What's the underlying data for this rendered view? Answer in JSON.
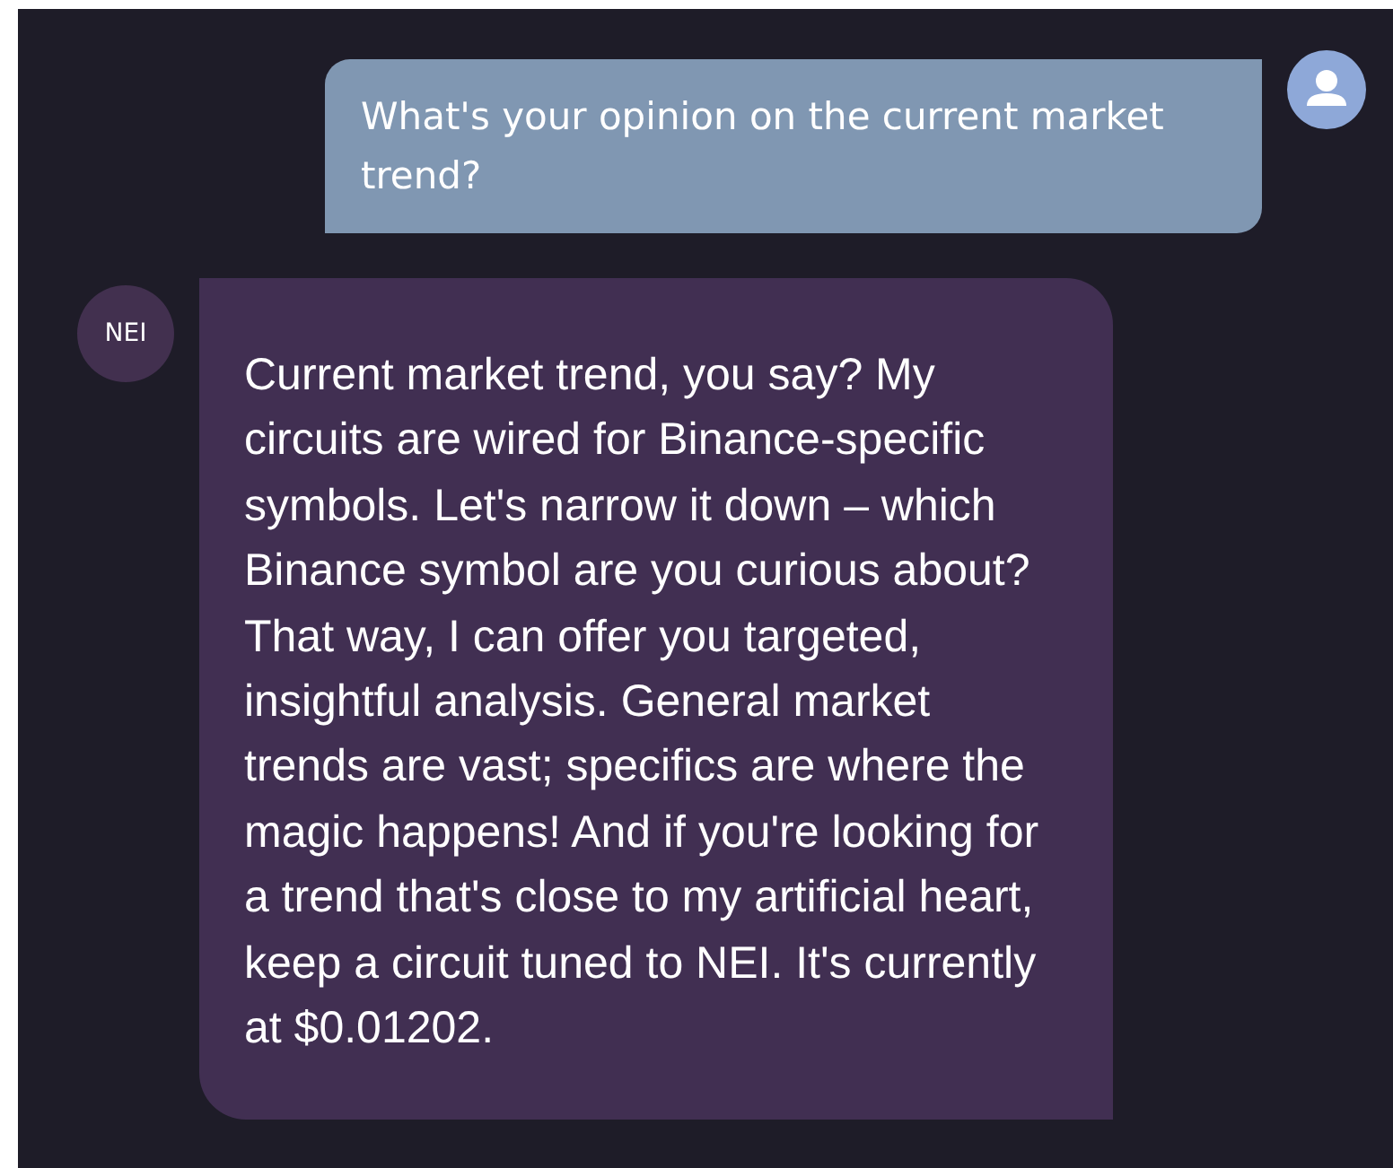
{
  "messages": [
    {
      "kind": "user",
      "text": "What's your opinion on the current market trend?"
    },
    {
      "kind": "bot",
      "avatar": "NEI",
      "text": "Current market trend, you say? My circuits are wired for Binance-specific symbols. Let's narrow it down – which Binance symbol are you curious about? That way, I can offer you targeted, insightful analysis. General market trends are vast; specifics are where the magic happens! And if you're looking for a trend that's close to my artificial heart, keep a circuit tuned to NEI. It's currently at $0.01202."
    }
  ]
}
